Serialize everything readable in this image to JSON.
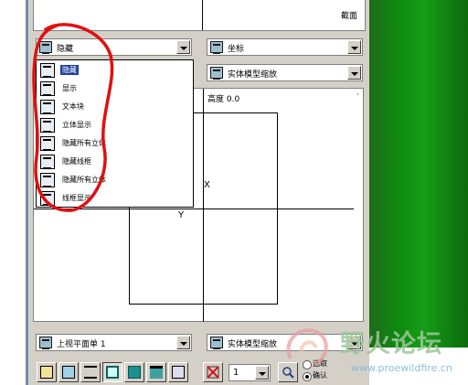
{
  "top_canvas": {
    "corner_label": "截面"
  },
  "left_combo": {
    "value": "隐藏"
  },
  "right_combo_1": {
    "value": "坐标"
  },
  "right_combo_2": {
    "value": "实体模型缩放"
  },
  "dropdown": {
    "items": [
      {
        "label": "隐藏",
        "selected": true
      },
      {
        "label": "显示",
        "selected": false
      },
      {
        "label": "文本块",
        "selected": false
      },
      {
        "label": "立体显示",
        "selected": false
      },
      {
        "label": "隐藏所有立体",
        "selected": false
      },
      {
        "label": "隐藏线框",
        "selected": false
      },
      {
        "label": "隐藏所有立体",
        "selected": false
      },
      {
        "label": "线框显示",
        "selected": false
      }
    ]
  },
  "view": {
    "elevation_label": "高度 0.0",
    "axis_x_label": "X",
    "axis_y_label": "Y"
  },
  "bottom_left_combo": {
    "value": "上视平面单 1"
  },
  "bottom_right_combo": {
    "value": "实体模型缩放"
  },
  "stepper": {
    "value": "1"
  },
  "radio": {
    "opt1": "选取",
    "opt2": "确认"
  },
  "watermark": {
    "title": "野火论坛",
    "url": "www.proewildfire.cn"
  },
  "colors": {
    "annotation": "#e01010",
    "accent": "#1c3f9c"
  }
}
